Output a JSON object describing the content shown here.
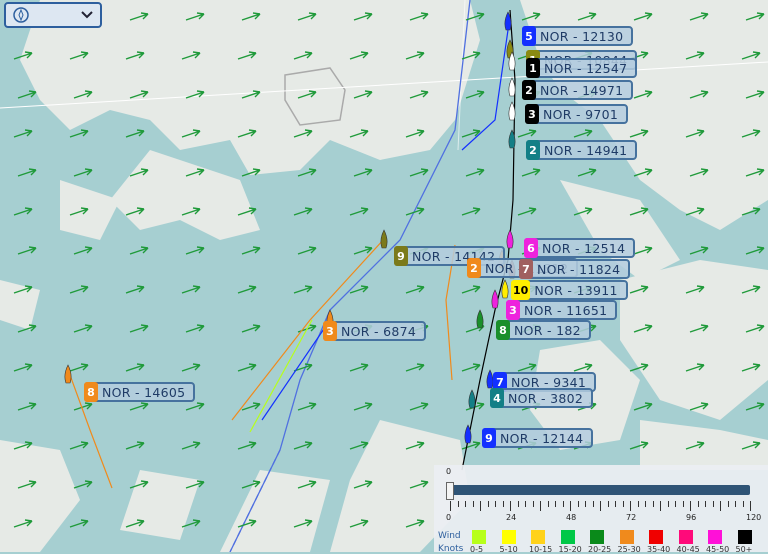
{
  "layer_selector": {
    "icon": "compass-icon",
    "dropdown_icon": "chevron-down-icon"
  },
  "colors": {
    "sea": "#a6cfd1",
    "land": "#e6eae6",
    "wind_arrow": "#1f9a3a",
    "label_bg": "#b4cdde",
    "label_border": "#46729e",
    "label_text": "#1f3b66"
  },
  "boats": [
    {
      "rank": "5",
      "name": "NOR - 12130",
      "rank_bg": "#1330ff",
      "rank_fg": "#ffffff"
    },
    {
      "rank": "1",
      "name": "NOR - 10844",
      "rank_bg": "#8a8a12",
      "rank_fg": "#ffffff"
    },
    {
      "rank": "1",
      "name": "NOR - 12547",
      "rank_bg": "#000000",
      "rank_fg": "#ffffff"
    },
    {
      "rank": "2",
      "name": "NOR - 14971",
      "rank_bg": "#000000",
      "rank_fg": "#ffffff"
    },
    {
      "rank": "3",
      "name": "NOR - 9701",
      "rank_bg": "#000000",
      "rank_fg": "#ffffff"
    },
    {
      "rank": "2",
      "name": "NOR - 14941",
      "rank_bg": "#137f86",
      "rank_fg": "#ffffff"
    },
    {
      "rank": "6",
      "name": "NOR - 12514",
      "rank_bg": "#ee22dd",
      "rank_fg": "#ffffff"
    },
    {
      "rank": "9",
      "name": "NOR - 14142",
      "rank_bg": "#7b7a1a",
      "rank_fg": "#ffffff"
    },
    {
      "rank": "2",
      "name": "NOR - 11312",
      "rank_bg": "#f08a1c",
      "rank_fg": "#ffffff"
    },
    {
      "rank": "7",
      "name": "NOR - 11824",
      "rank_bg": "#a06060",
      "rank_fg": "#ffffff"
    },
    {
      "rank": "10",
      "name": "NOR - 13911",
      "rank_bg": "#ffee00",
      "rank_fg": "#000000"
    },
    {
      "rank": "3",
      "name": "NOR - 11651",
      "rank_bg": "#ee22dd",
      "rank_fg": "#ffffff"
    },
    {
      "rank": "3",
      "name": "NOR - 6874",
      "rank_bg": "#f08a1c",
      "rank_fg": "#ffffff"
    },
    {
      "rank": "8",
      "name": "NOR - 182",
      "rank_bg": "#1a8f2a",
      "rank_fg": "#ffffff"
    },
    {
      "rank": "7",
      "name": "NOR - 9341",
      "rank_bg": "#1330ff",
      "rank_fg": "#ffffff"
    },
    {
      "rank": "4",
      "name": "NOR - 3802",
      "rank_bg": "#137f86",
      "rank_fg": "#ffffff"
    },
    {
      "rank": "9",
      "name": "NOR - 12144",
      "rank_bg": "#1330ff",
      "rank_fg": "#ffffff"
    },
    {
      "rank": "8",
      "name": "NOR - 14605",
      "rank_bg": "#f08a1c",
      "rank_fg": "#ffffff"
    }
  ],
  "timeline": {
    "current": "0",
    "ticks": [
      "0",
      "24",
      "48",
      "72",
      "96",
      "120"
    ]
  },
  "legend": {
    "wind_label": "Wind",
    "knots_label": "Knots",
    "bins": [
      {
        "range": "0-5",
        "color": "#b7ff1a"
      },
      {
        "range": "5-10",
        "color": "#ffff00"
      },
      {
        "range": "10-15",
        "color": "#ffd21a"
      },
      {
        "range": "15-20",
        "color": "#00c847"
      },
      {
        "range": "20-25",
        "color": "#0a8a1a"
      },
      {
        "range": "25-30",
        "color": "#f08a1c"
      },
      {
        "range": "35-40",
        "color": "#f00000"
      },
      {
        "range": "40-45",
        "color": "#ff0a7a"
      },
      {
        "range": "45-50",
        "color": "#ff10d8"
      },
      {
        "range": "50+",
        "color": "#000000"
      }
    ]
  }
}
